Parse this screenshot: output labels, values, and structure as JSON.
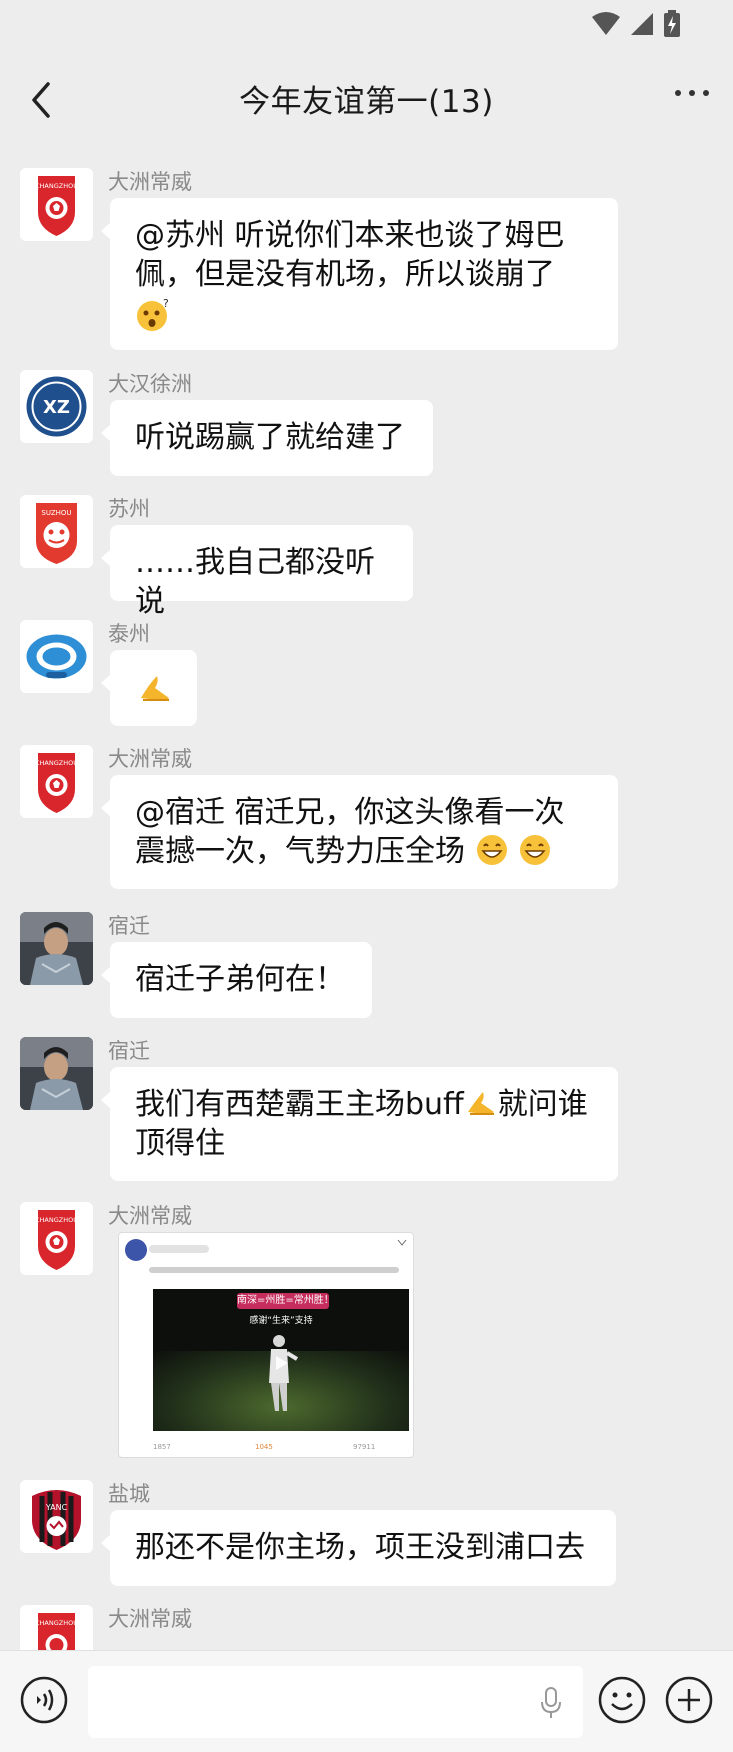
{
  "header": {
    "title": "今年友谊第一(13)"
  },
  "messages": [
    {
      "sender": "大洲常威",
      "text": "@苏州 听说你们本来也谈了姆巴佩，但是没有机场，所以谈崩了",
      "avatar": "changzhou-logo"
    },
    {
      "sender": "大汉徐洲",
      "text": "听说踢赢了就给建了",
      "avatar": "xuzhou-logo"
    },
    {
      "sender": "苏州",
      "text": "……我自己都没听说",
      "avatar": "suzhou-logo"
    },
    {
      "sender": "泰州",
      "text": "",
      "avatar": "taizhou-logo"
    },
    {
      "sender": "大洲常威",
      "text": "@宿迁 宿迁兄，你这头像看一次震撼一次，气势力压全场",
      "avatar": "changzhou-logo"
    },
    {
      "sender": "宿迁",
      "text": "宿迁子弟何在！",
      "avatar": "suqian-photo"
    },
    {
      "sender": "宿迁",
      "text_a": "我们有西楚霸王主场buff",
      "text_b": "就问谁顶得住",
      "avatar": "suqian-photo"
    },
    {
      "sender": "大洲常威",
      "avatar": "changzhou-logo",
      "card": {
        "banner": "南深=州胜=常州胜！",
        "caption": "感谢“生来”支持",
        "stats": [
          "1857",
          "1045",
          "97911"
        ]
      }
    },
    {
      "sender": "盐城",
      "text": "那还不是你主场，项王没到浦口去",
      "avatar": "yancheng-logo"
    },
    {
      "sender": "大洲常威",
      "avatar": "changzhou-logo"
    }
  ],
  "avatar_text": {
    "changzhou": "CHANGZHOU",
    "xuzhou": "XZ",
    "suzhou": "SUZHOU",
    "yancheng": "YANC"
  },
  "icons": {
    "back": "back-arrow-icon",
    "more": "more-icon",
    "voice": "voice-icon",
    "mic": "microphone-icon",
    "emoji": "emoji-icon",
    "plus": "plus-icon"
  },
  "colors": {
    "background": "#ededed",
    "bubble": "#ffffff",
    "sender": "#8a8a8a",
    "changzhou_red": "#d9262c"
  }
}
